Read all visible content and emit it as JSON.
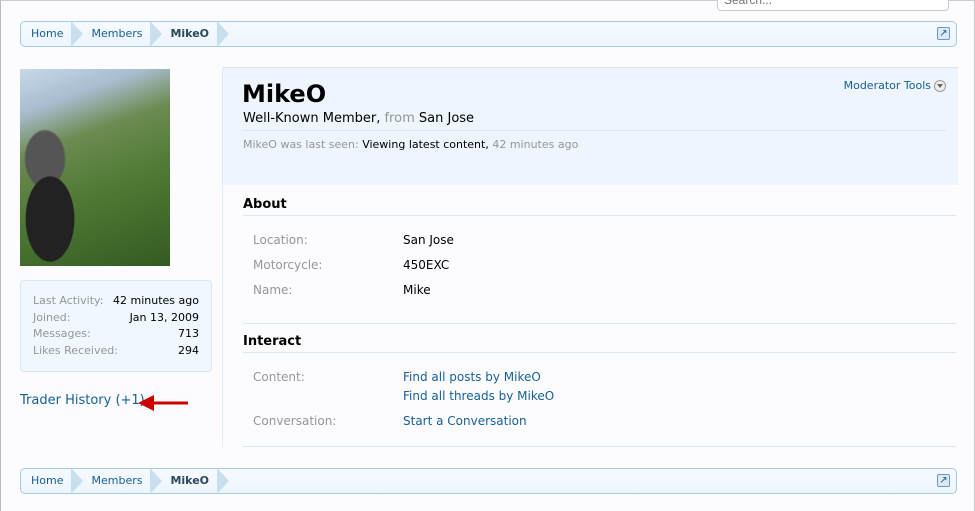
{
  "search": {
    "placeholder": "Search..."
  },
  "breadcrumb": [
    "Home",
    "Members",
    "MikeO"
  ],
  "sidebar": {
    "stats": [
      {
        "label": "Last Activity:",
        "value": "42 minutes ago"
      },
      {
        "label": "Joined:",
        "value": "Jan 13, 2009"
      },
      {
        "label": "Messages:",
        "value": "713"
      },
      {
        "label": "Likes Received:",
        "value": "294"
      }
    ],
    "trader_history": "Trader History (+1)",
    "arrow_color": "#cc0000"
  },
  "profile": {
    "name": "MikeO",
    "title": "Well-Known Member,",
    "from_word": "from",
    "location": "San Jose",
    "seen_prefix": "MikeO was last seen:",
    "seen_activity": "Viewing latest content,",
    "seen_time": "42 minutes ago",
    "moderator_tools": "Moderator Tools"
  },
  "about": {
    "heading": "About",
    "rows": [
      {
        "label": "Location:",
        "value": "San Jose"
      },
      {
        "label": "Motorcycle:",
        "value": "450EXC"
      },
      {
        "label": "Name:",
        "value": "Mike"
      }
    ]
  },
  "interact": {
    "heading": "Interact",
    "content_label": "Content:",
    "find_posts": "Find all posts by MikeO",
    "find_threads": "Find all threads by MikeO",
    "conversation_label": "Conversation:",
    "start_conversation": "Start a Conversation"
  }
}
